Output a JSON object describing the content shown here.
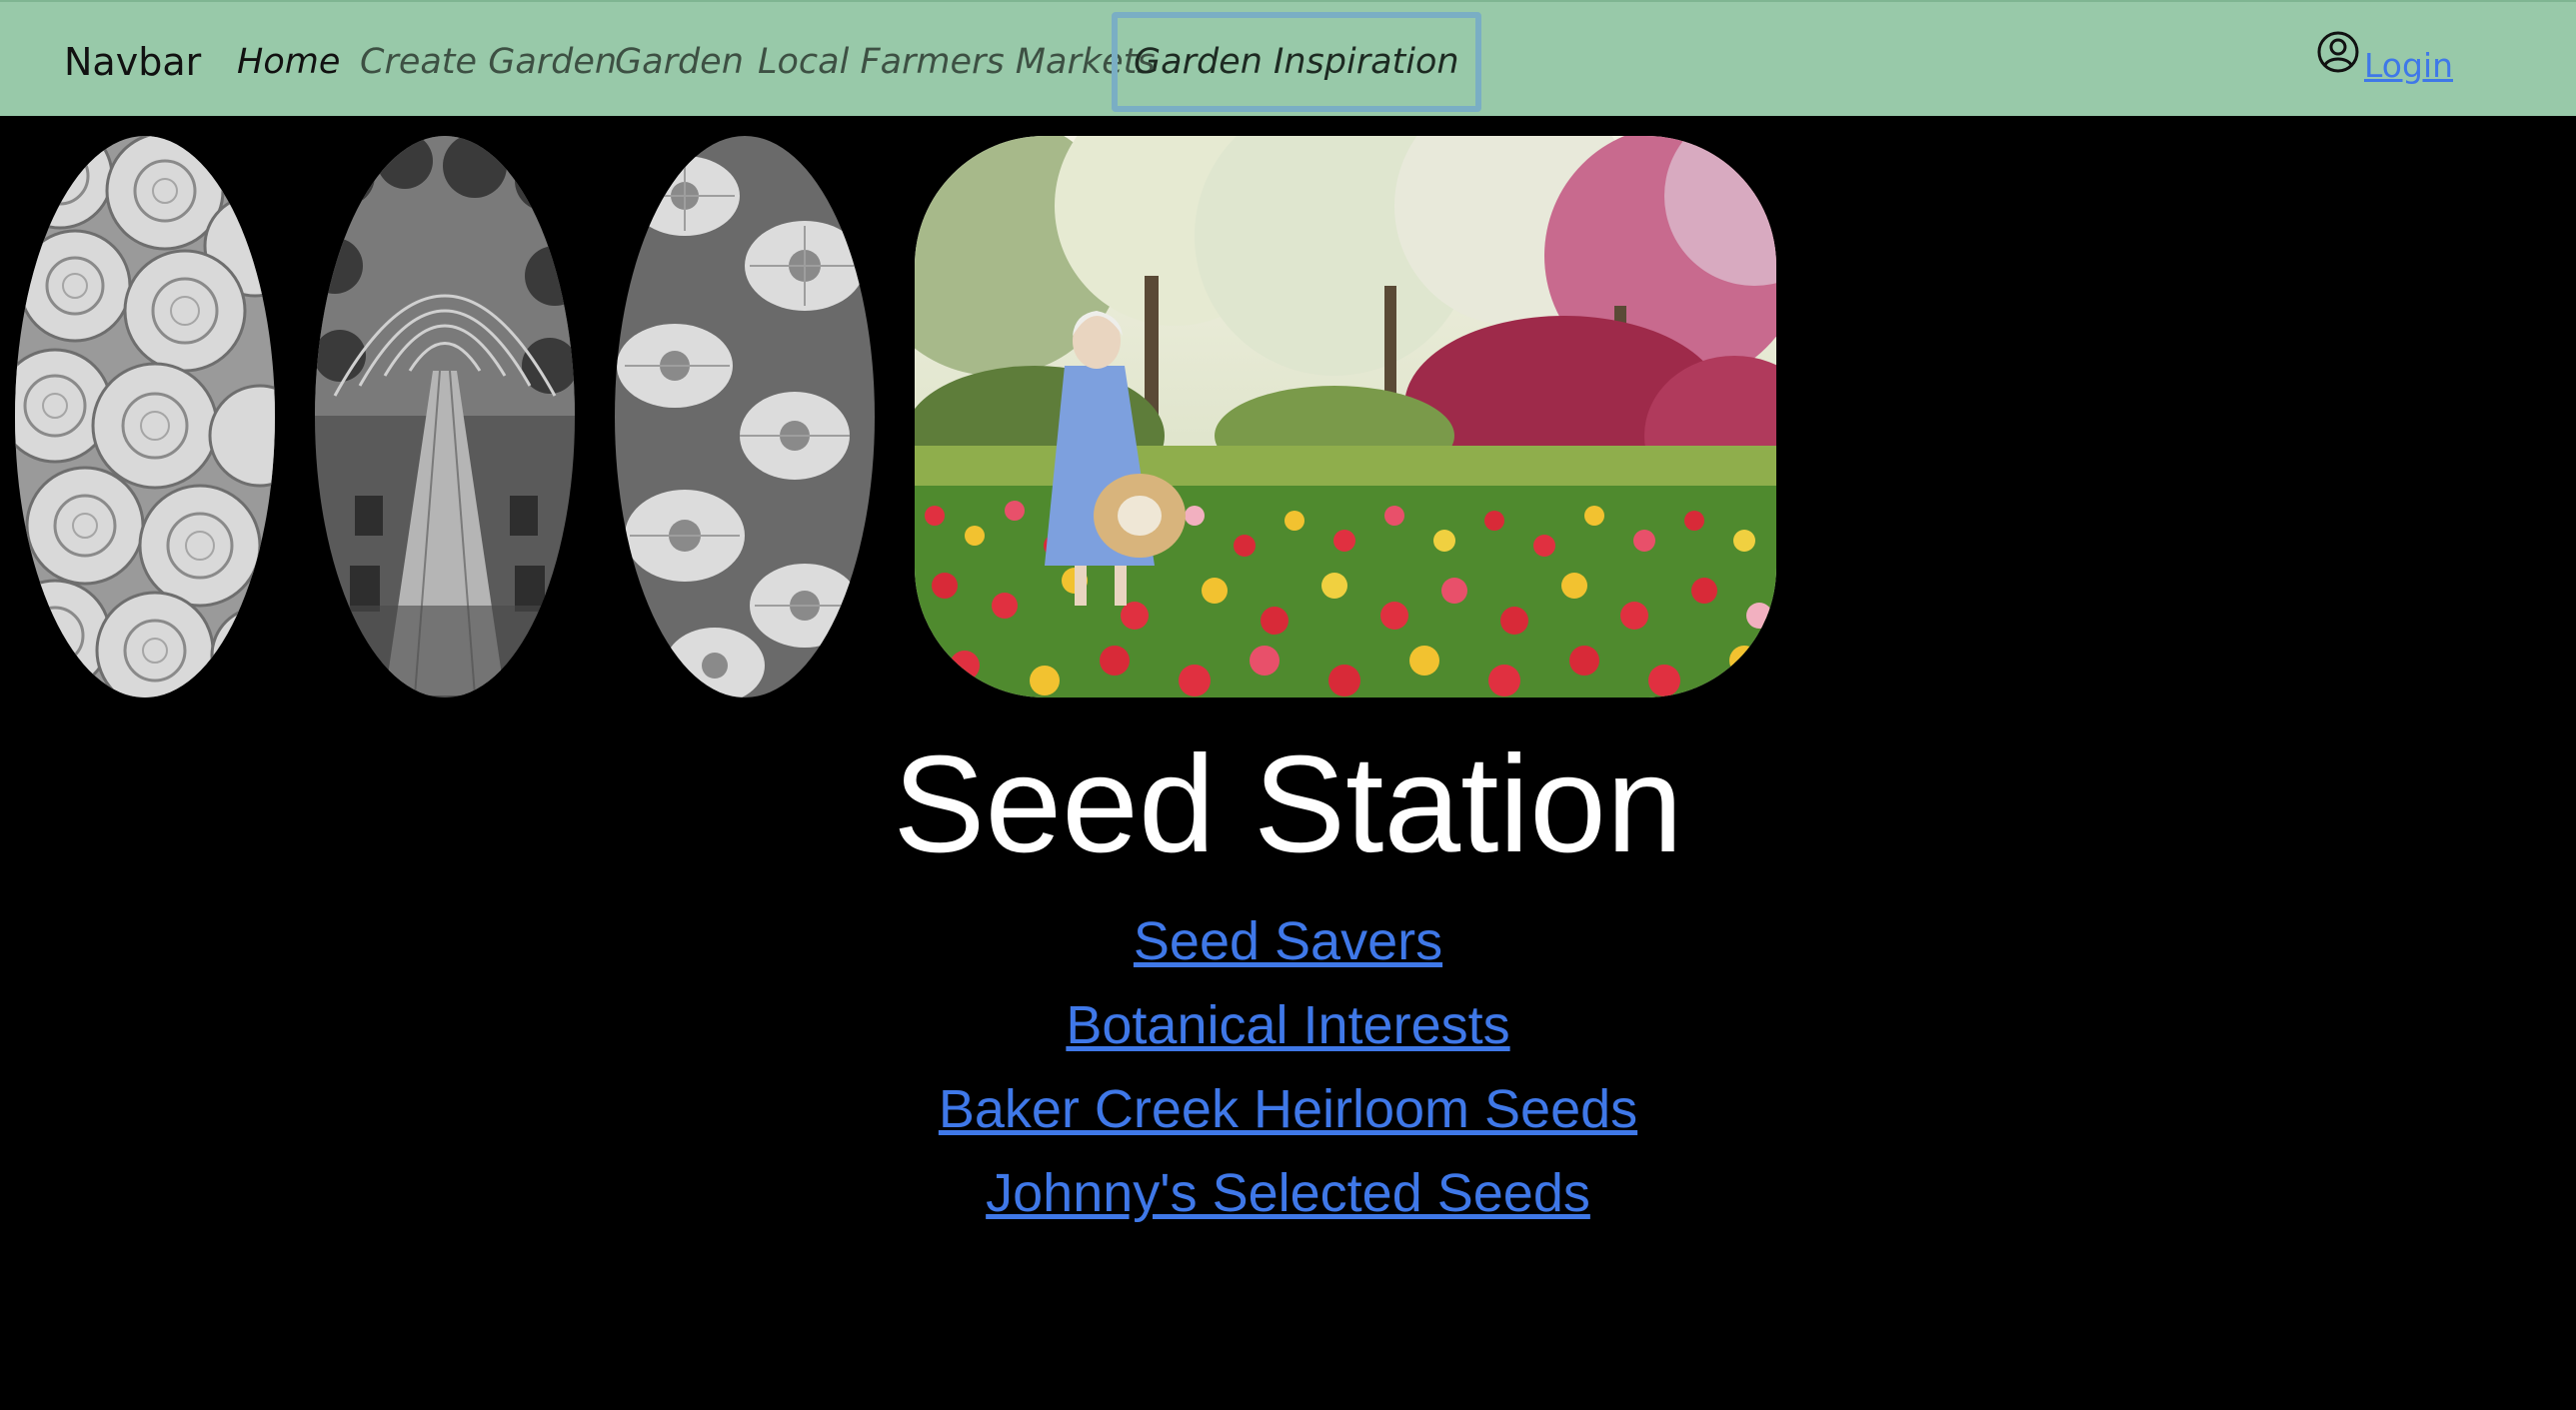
{
  "navbar": {
    "brand": "Navbar",
    "links": [
      {
        "label": "Home"
      },
      {
        "label": "Create Garden"
      },
      {
        "label": "Garden"
      },
      {
        "label": "Local Farmers Markets"
      },
      {
        "label": "Garden Inspiration"
      }
    ],
    "login_label": "Login",
    "background_color": "#98c9a9",
    "focus_outline_color": "#7aaec4"
  },
  "gallery": {
    "images": [
      {
        "icon": "roses-photo"
      },
      {
        "icon": "garden-arbor-table-photo"
      },
      {
        "icon": "daisies-photo"
      },
      {
        "icon": "tulip-field-woman-photo"
      }
    ]
  },
  "main": {
    "title": "Seed Station",
    "links": [
      {
        "label": "Seed Savers"
      },
      {
        "label": "Botanical Interests"
      },
      {
        "label": "Baker Creek Heirloom Seeds"
      },
      {
        "label": "Johnny's Selected Seeds"
      }
    ],
    "link_color": "#3f78e8",
    "page_background": "#000000"
  }
}
